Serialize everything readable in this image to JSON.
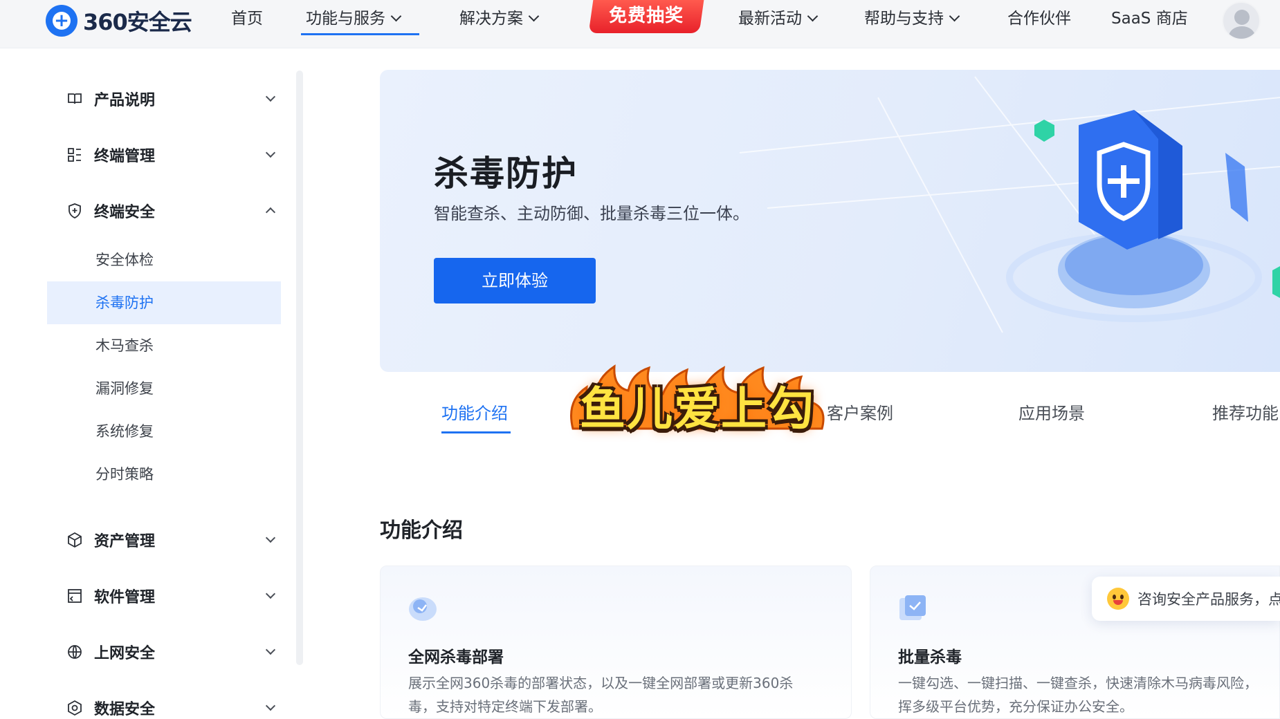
{
  "header": {
    "brand": "360安全云",
    "nav": [
      {
        "label": "首页"
      },
      {
        "label": "功能与服务"
      },
      {
        "label": "解决方案"
      },
      {
        "label": "最新活动"
      },
      {
        "label": "帮助与支持"
      },
      {
        "label": "合作伙伴"
      },
      {
        "label": "SaaS 商店"
      }
    ],
    "promo": "免费抽奖"
  },
  "sidebar": {
    "groups": [
      {
        "label": "产品说明",
        "icon": "book-icon"
      },
      {
        "label": "终端管理",
        "icon": "grid-icon"
      },
      {
        "label": "终端安全",
        "icon": "shield-icon"
      },
      {
        "label": "资产管理",
        "icon": "cube-icon"
      },
      {
        "label": "软件管理",
        "icon": "software-icon"
      },
      {
        "label": "上网安全",
        "icon": "globe-icon"
      },
      {
        "label": "数据安全",
        "icon": "data-icon"
      }
    ],
    "subitems": [
      {
        "label": "安全体检"
      },
      {
        "label": "杀毒防护"
      },
      {
        "label": "木马查杀"
      },
      {
        "label": "漏洞修复"
      },
      {
        "label": "系统修复"
      },
      {
        "label": "分时策略"
      }
    ],
    "active_sub": "杀毒防护"
  },
  "banner": {
    "title": "杀毒防护",
    "subtitle": "智能查杀、主动防御、批量杀毒三位一体。",
    "cta": "立即体验"
  },
  "tabs": [
    {
      "label": "功能介绍"
    },
    {
      "label": "客户案例"
    },
    {
      "label": "应用场景"
    },
    {
      "label": "推荐功能"
    }
  ],
  "overlay": "鱼儿爱上勾",
  "section": {
    "title": "功能介绍",
    "cards": [
      {
        "title": "全网杀毒部署",
        "desc_line1": "展示全网360杀毒的部署状态，以及一键全网部署或更新360杀",
        "desc_line2": "毒，支持对特定终端下发部署。"
      },
      {
        "title": "批量杀毒",
        "desc_line1": "一键勾选、一键扫描、一键查杀，快速清除木马病毒风险，",
        "desc_line2": "挥多级平台优势，充分保证办公安全。"
      }
    ]
  },
  "chat": {
    "text": "咨询安全产品服务，点"
  },
  "colors": {
    "accent": "#1e72f2",
    "promo": "#e8212a",
    "active_bg": "#e8f0fe"
  }
}
